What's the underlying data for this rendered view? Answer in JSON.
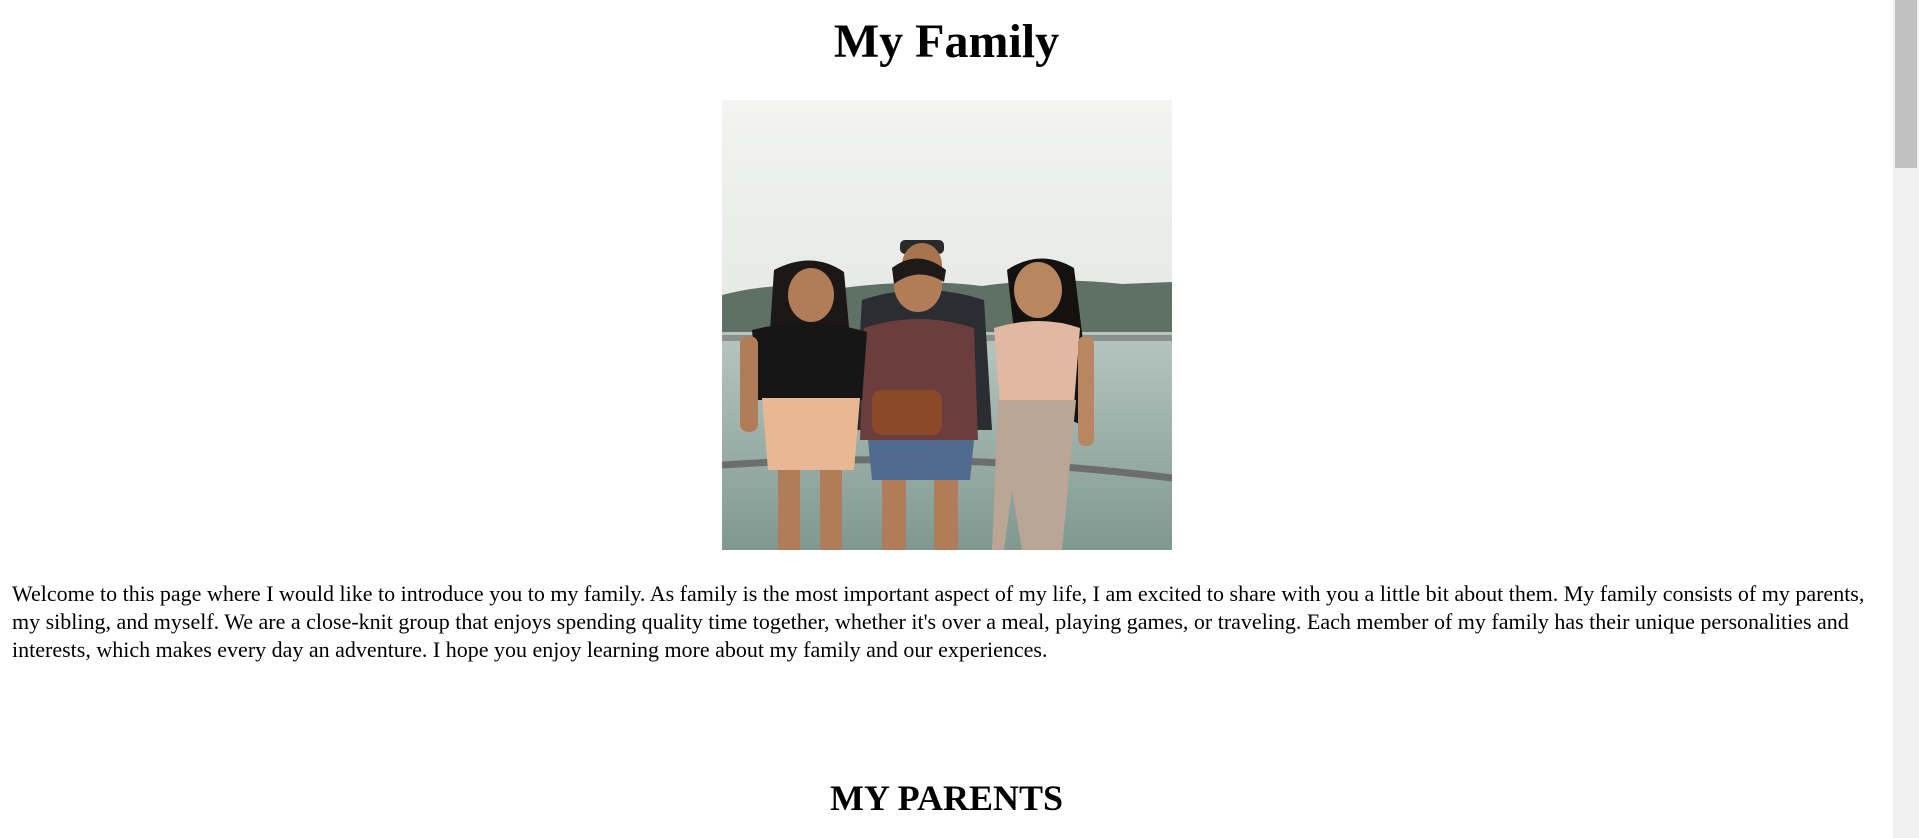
{
  "page": {
    "title": "My Family",
    "intro": "Welcome to this page where I would like to introduce you to my family. As family is the most important aspect of my life, I am excited to share with you a little bit about them. My family consists of my parents, my sibling, and myself. We are a close-knit group that enjoys spending quality time together, whether it's over a meal, playing games, or traveling. Each member of my family has their unique personalities and interests, which makes every day an adventure. I hope you enjoy learning more about my family and our experiences.",
    "section_title": "MY PARENTS"
  },
  "photo": {
    "subject": "family-photo",
    "colors": {
      "sky": "#eef0ee",
      "hills": "#5f7064",
      "water": "#9fb2ab",
      "railing": "#6b6e6c"
    }
  },
  "scrollbar": {
    "track_color": "#f1f1f1",
    "thumb_color": "#c1c1c1"
  }
}
